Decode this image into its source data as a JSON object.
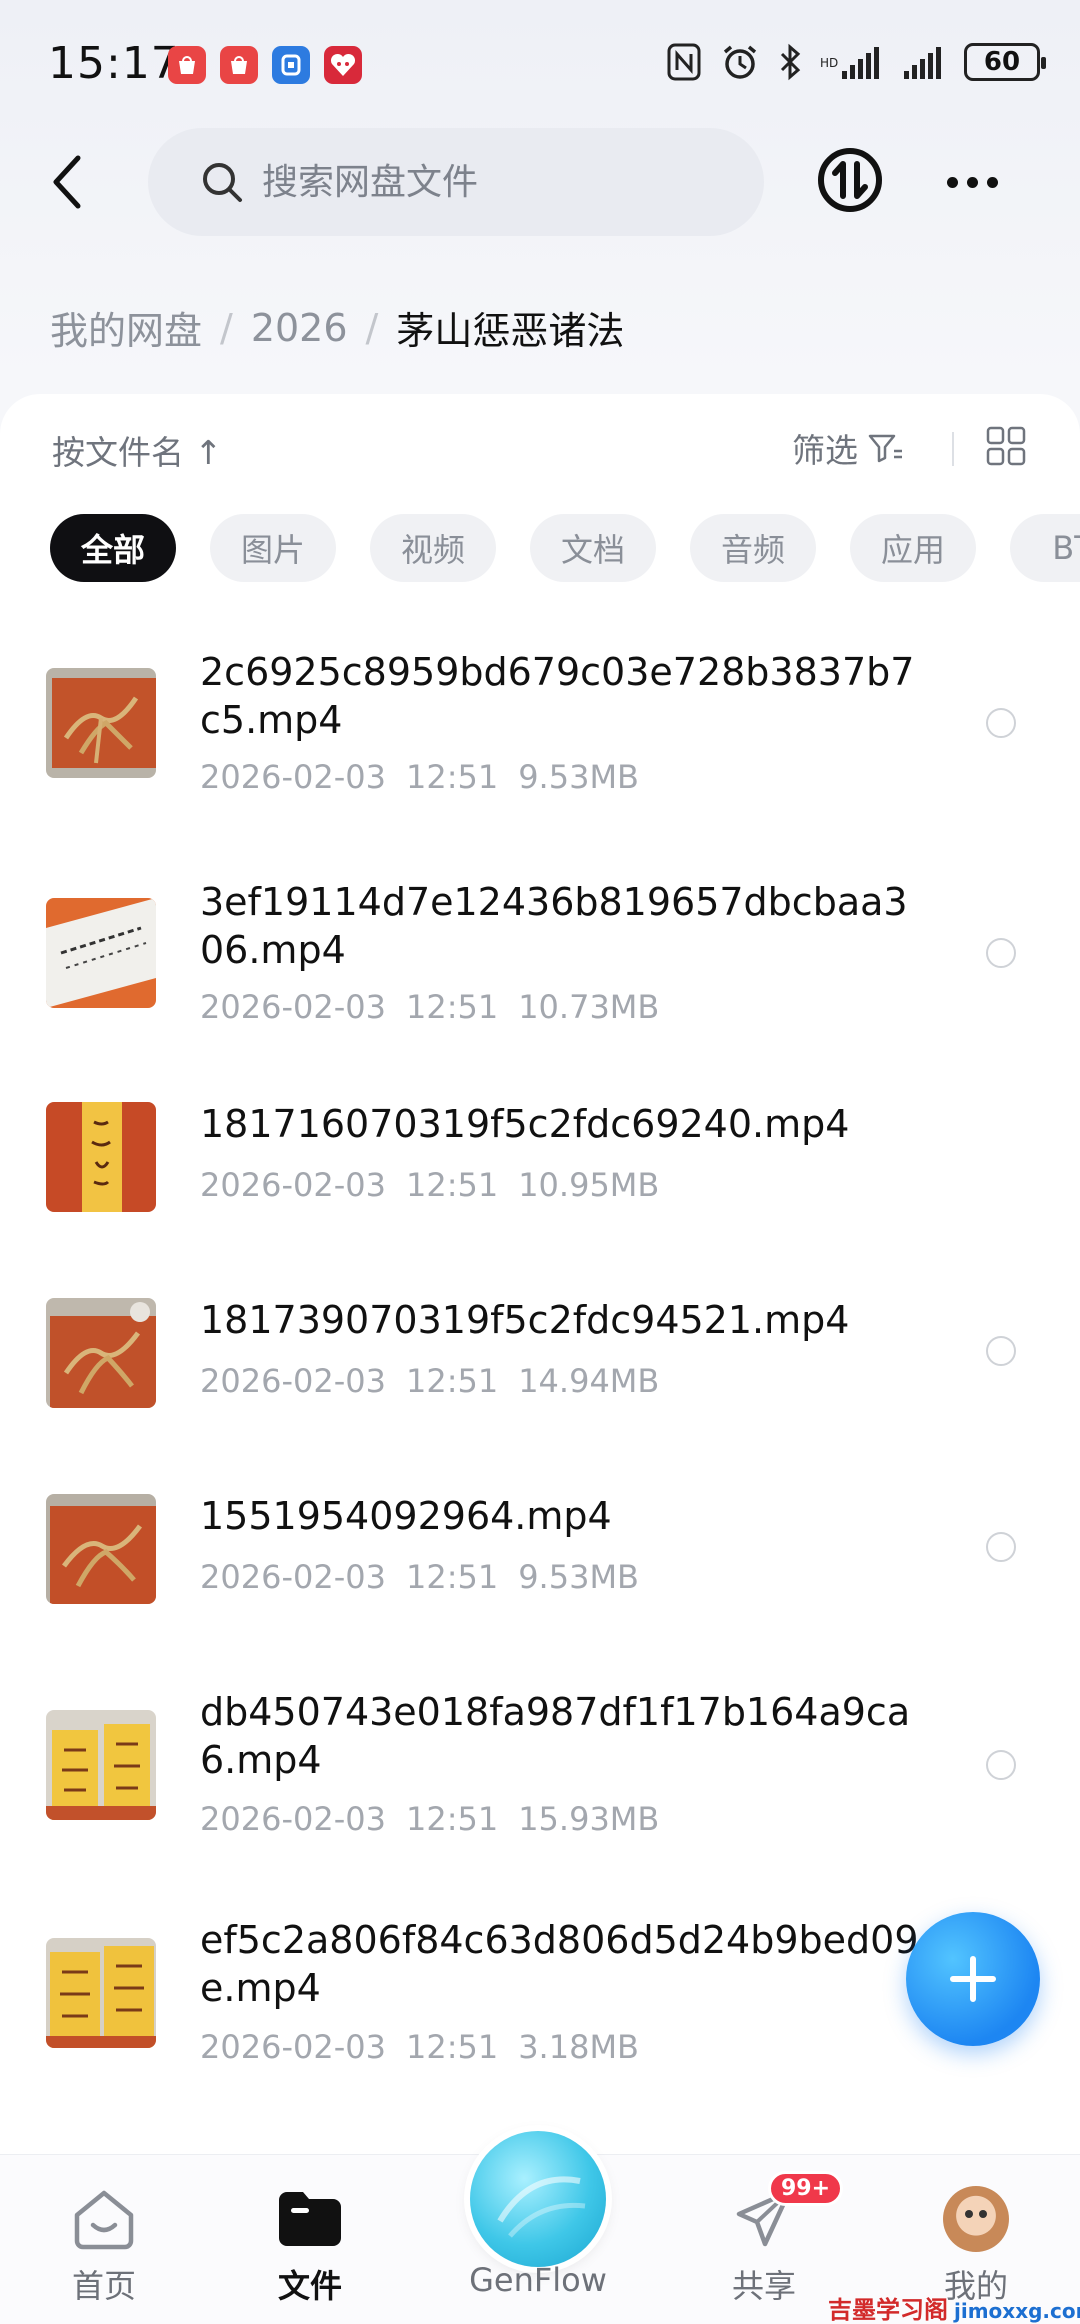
{
  "status_bar": {
    "time": "15:17",
    "notifications": [
      {
        "icon": "huawei-store-icon",
        "color": "#e94545"
      },
      {
        "icon": "huawei-store-icon",
        "color": "#e94545"
      },
      {
        "icon": "security-app-icon",
        "color": "#2d7be0"
      },
      {
        "icon": "pinduoduo-icon",
        "color": "#d8293a"
      }
    ],
    "battery": "60"
  },
  "search": {
    "placeholder": "搜索网盘文件"
  },
  "breadcrumb": {
    "items": [
      "我的网盘",
      "2026",
      "茅山惩恶诸法"
    ]
  },
  "toolbar": {
    "sort_label": "按文件名 ↑",
    "filter_label": "筛选"
  },
  "chips": [
    "全部",
    "图片",
    "视频",
    "文档",
    "音频",
    "应用",
    "BT"
  ],
  "active_chip": "全部",
  "files": [
    {
      "name": "2c6925c8959bd679c03e728b3837b7c5.mp4",
      "date": "2026-02-03",
      "time": "12:51",
      "size": "9.53MB",
      "thumb": "roots-on-orange"
    },
    {
      "name": "3ef19114d7e12436b819657dbcbaa306.mp4",
      "date": "2026-02-03",
      "time": "12:51",
      "size": "10.73MB",
      "thumb": "talisman-white"
    },
    {
      "name": "181716070319f5c2fdc69240.mp4",
      "date": "2026-02-03",
      "time": "12:51",
      "size": "10.95MB",
      "thumb": "talisman-yellow"
    },
    {
      "name": "181739070319f5c2fdc94521.mp4",
      "date": "2026-02-03",
      "time": "12:51",
      "size": "14.94MB",
      "thumb": "roots-on-orange"
    },
    {
      "name": "1551954092964.mp4",
      "date": "2026-02-03",
      "time": "12:51",
      "size": "9.53MB",
      "thumb": "roots-on-orange"
    },
    {
      "name": "db450743e018fa987df1f17b164a9ca6.mp4",
      "date": "2026-02-03",
      "time": "12:51",
      "size": "15.93MB",
      "thumb": "talisman-pair"
    },
    {
      "name": "ef5c2a806f84c63d806d5d24b9bed09e.mp4",
      "date": "2026-02-03",
      "time": "12:51",
      "size": "3.18MB",
      "thumb": "talisman-pair"
    }
  ],
  "bottom_nav": {
    "items": [
      {
        "label": "首页",
        "icon": "home-icon"
      },
      {
        "label": "文件",
        "icon": "folder-icon",
        "active": true
      },
      {
        "label": "GenFlow",
        "icon": "genflow-orb-icon"
      },
      {
        "label": "共享",
        "icon": "paper-plane-icon",
        "badge": "99+"
      },
      {
        "label": "我的",
        "icon": "avatar-icon"
      }
    ]
  },
  "watermark": {
    "cn": "吉墨学习阁",
    "en": "jimoxxg.com"
  },
  "colors": {
    "accent": "#1d86f2",
    "badge": "#f0384a",
    "active_chip": "#0f0f12"
  }
}
